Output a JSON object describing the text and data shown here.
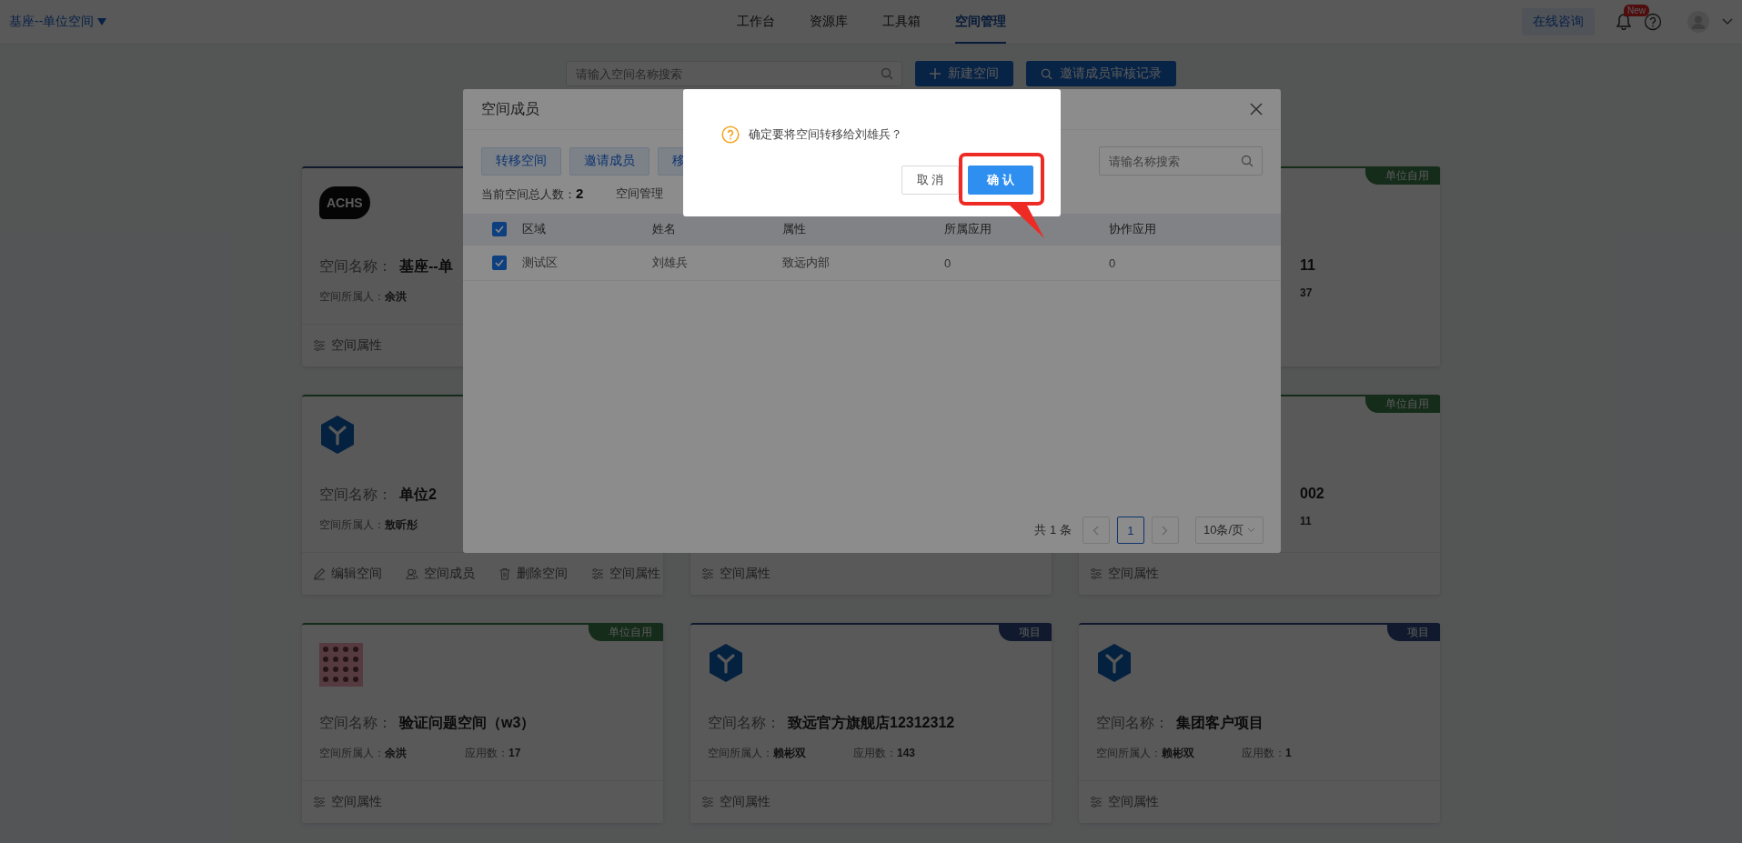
{
  "header": {
    "space_switcher": "基座--单位空间",
    "nav": [
      {
        "label": "工作台",
        "selected": false
      },
      {
        "label": "资源库",
        "selected": false
      },
      {
        "label": "工具箱",
        "selected": false
      },
      {
        "label": "空间管理",
        "selected": true
      }
    ],
    "consult_button": "在线咨询",
    "notification_badge": "New"
  },
  "toolbar": {
    "search": {
      "placeholder": "请输入空间名称搜索"
    },
    "buttons": [
      {
        "label": "新建空间",
        "kind": "plus"
      },
      {
        "label": "邀请成员审核记录",
        "kind": "search"
      }
    ]
  },
  "cards": [
    {
      "kind": "project",
      "logo": {
        "kind": "bubble",
        "text": "ACHS"
      },
      "name_label": "空间名称：",
      "name": "基座--单",
      "owner_label": "空间所属人：",
      "owner": "余洪",
      "actions": [
        {
          "kind": "properties",
          "label": "空间属性"
        }
      ]
    },
    {
      "kind": "unit",
      "tag": "单位自用",
      "name_fragment": "11",
      "detail_fragment": "37"
    },
    {
      "kind": "unit",
      "logo": {
        "kind": "hexagon"
      },
      "name_label": "空间名称：",
      "name": "单位2",
      "owner_label": "空间所属人：",
      "owner": "敖昕彤",
      "actions": [
        {
          "kind": "edit",
          "label": "编辑空间"
        },
        {
          "kind": "members",
          "label": "空间成员"
        },
        {
          "kind": "delete",
          "label": "删除空间"
        },
        {
          "kind": "properties",
          "label": "空间属性"
        }
      ]
    },
    {
      "actions": [
        {
          "kind": "properties",
          "label": "空间属性"
        }
      ]
    },
    {
      "kind": "unit",
      "tag": "单位自用",
      "name_fragment": "002",
      "detail_fragment": "11",
      "actions": [
        {
          "kind": "properties",
          "label": "空间属性"
        }
      ]
    },
    {
      "kind": "unit",
      "tag": "单位自用",
      "logo": {
        "kind": "pattern"
      },
      "name_label": "空间名称：",
      "name": "验证问题空间（w3）",
      "owner_label": "空间所属人：",
      "owner": "余洪",
      "apps_label": "应用数：",
      "apps": "17",
      "actions": [
        {
          "kind": "properties",
          "label": "空间属性"
        }
      ]
    },
    {
      "kind": "project",
      "tag": "项目",
      "logo": {
        "kind": "hexagon"
      },
      "name_label": "空间名称：",
      "name": "致远官方旗舰店12312312",
      "owner_label": "空间所属人：",
      "owner": "赖彬双",
      "apps_label": "应用数：",
      "apps": "143",
      "actions": [
        {
          "kind": "properties",
          "label": "空间属性"
        }
      ]
    },
    {
      "kind": "project",
      "tag": "项目",
      "logo": {
        "kind": "hexagon"
      },
      "name_label": "空间名称：",
      "name": "集团客户项目",
      "owner_label": "空间所属人：",
      "owner": "赖彬双",
      "apps_label": "应用数：",
      "apps": "1",
      "actions": [
        {
          "kind": "properties",
          "label": "空间属性"
        }
      ]
    }
  ],
  "member_dialog": {
    "title": "空间成员",
    "actions": [
      {
        "label": "转移空间"
      },
      {
        "label": "邀请成员"
      },
      {
        "label": "移"
      }
    ],
    "search": {
      "placeholder": "请输名称搜索"
    },
    "total_label": "当前空间总人数：",
    "total": "2",
    "admin_label": "空间管理",
    "table": {
      "all_checked": true,
      "columns": [
        "区域",
        "姓名",
        "属性",
        "所属应用",
        "协作应用"
      ],
      "rows": [
        {
          "checked": true,
          "cells": [
            "测试区",
            "刘雄兵",
            "致远内部",
            "0",
            "0"
          ]
        }
      ]
    },
    "pagination": {
      "total": "共 1 条",
      "pages": [
        {
          "label": "1",
          "selected": true
        }
      ],
      "page_size": "10条/页"
    }
  },
  "confirm_dialog": {
    "message": "确定要将空间转移给刘雄兵？",
    "buttons": [
      {
        "label": "取 消",
        "kind": "default",
        "highlighted": false
      },
      {
        "label": "确 认",
        "kind": "primary",
        "highlighted": true
      }
    ]
  }
}
